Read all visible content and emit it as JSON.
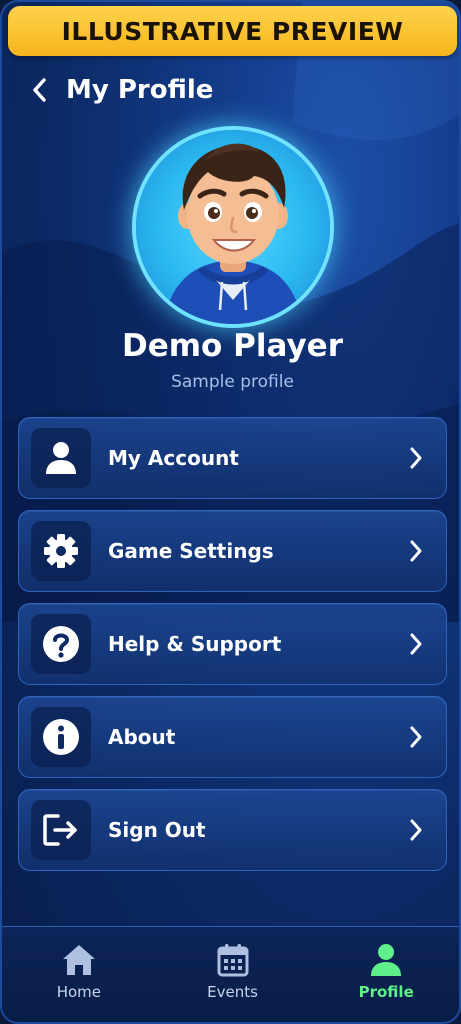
{
  "banner": {
    "text": "ILLUSTRATIVE PREVIEW"
  },
  "header": {
    "title": "My Profile"
  },
  "profile": {
    "name": "Demo Player",
    "subtitle": "Sample profile"
  },
  "menu": {
    "items": [
      {
        "label": "My Account",
        "icon": "user-icon"
      },
      {
        "label": "Game Settings",
        "icon": "gear-icon"
      },
      {
        "label": "Help & Support",
        "icon": "question-icon"
      },
      {
        "label": "About",
        "icon": "info-icon"
      },
      {
        "label": "Sign Out",
        "icon": "sign-out-icon"
      }
    ]
  },
  "tabbar": {
    "tabs": [
      {
        "label": "Home",
        "icon": "home-icon",
        "active": false
      },
      {
        "label": "Events",
        "icon": "calendar-icon",
        "active": false
      },
      {
        "label": "Profile",
        "icon": "profile-icon",
        "active": true
      }
    ]
  },
  "colors": {
    "banner": "#f6b51d",
    "background": "#0c2a66",
    "active_tab": "#5ff08a",
    "avatar_glow": "#56d8ff"
  }
}
